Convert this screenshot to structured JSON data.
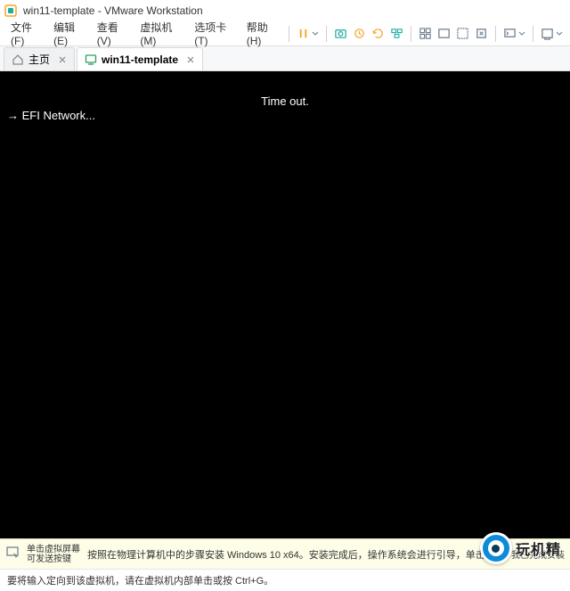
{
  "window": {
    "title": "win11-template - VMware Workstation"
  },
  "menu": {
    "file": "文件(F)",
    "edit": "编辑(E)",
    "view": "查看(V)",
    "vm": "虚拟机(M)",
    "tabs": "选项卡(T)",
    "help": "帮助(H)"
  },
  "tabs": {
    "home": "主页",
    "vm": "win11-template"
  },
  "console": {
    "line_timeout": "Time out.",
    "line_efi": "→ EFI Network..."
  },
  "helper": {
    "left_line1": "单击虚拟屏幕",
    "left_line2": "可发送按键",
    "message": "按照在物理计算机中的步骤安装 Windows 10 x64。安装完成后，操作系统会进行引导，单击\"我已完成安装\"。",
    "right_btn": "我已完成安装"
  },
  "status": {
    "text": "要将输入定向到该虚拟机，请在虚拟机内部单击或按 Ctrl+G。"
  },
  "watermark": {
    "text": "玩机精"
  },
  "icons": {
    "home": "home-icon",
    "vm": "vm-icon",
    "close": "close-icon"
  }
}
